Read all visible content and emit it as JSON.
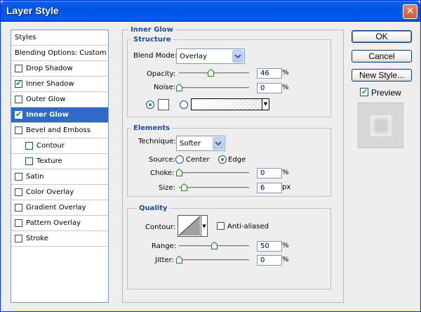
{
  "window": {
    "title": "Layer Style",
    "close_glyph": "✕"
  },
  "styles": {
    "header": "Styles",
    "blending": "Blending Options: Custom",
    "items": [
      {
        "label": "Drop Shadow",
        "checked": false,
        "indent": false,
        "selected": false
      },
      {
        "label": "Inner Shadow",
        "checked": true,
        "indent": false,
        "selected": false
      },
      {
        "label": "Outer Glow",
        "checked": false,
        "indent": false,
        "selected": false
      },
      {
        "label": "Inner Glow",
        "checked": true,
        "indent": false,
        "selected": true
      },
      {
        "label": "Bevel and Emboss",
        "checked": false,
        "indent": false,
        "selected": false
      },
      {
        "label": "Contour",
        "checked": false,
        "indent": true,
        "selected": false
      },
      {
        "label": "Texture",
        "checked": false,
        "indent": true,
        "selected": false
      },
      {
        "label": "Satin",
        "checked": false,
        "indent": false,
        "selected": false
      },
      {
        "label": "Color Overlay",
        "checked": false,
        "indent": false,
        "selected": false
      },
      {
        "label": "Gradient Overlay",
        "checked": false,
        "indent": false,
        "selected": false
      },
      {
        "label": "Pattern Overlay",
        "checked": false,
        "indent": false,
        "selected": false
      },
      {
        "label": "Stroke",
        "checked": false,
        "indent": false,
        "selected": false
      }
    ]
  },
  "inner_glow": {
    "title": "Inner Glow",
    "structure": {
      "title": "Structure",
      "blend_mode_label": "Blend Mode:",
      "blend_mode_value": "Overlay",
      "opacity_label": "Opacity:",
      "opacity_value": "46",
      "opacity_unit": "%",
      "noise_label": "Noise:",
      "noise_value": "0",
      "noise_unit": "%"
    },
    "elements": {
      "title": "Elements",
      "technique_label": "Technique:",
      "technique_value": "Softer",
      "source_label": "Source:",
      "source_center": "Center",
      "source_edge": "Edge",
      "choke_label": "Choke:",
      "choke_value": "0",
      "choke_unit": "%",
      "size_label": "Size:",
      "size_value": "6",
      "size_unit": "px"
    },
    "quality": {
      "title": "Quality",
      "contour_label": "Contour:",
      "antialiased_label": "Anti-aliased",
      "range_label": "Range:",
      "range_value": "50",
      "range_unit": "%",
      "jitter_label": "Jitter:",
      "jitter_value": "0",
      "jitter_unit": "%"
    }
  },
  "buttons": {
    "ok": "OK",
    "cancel": "Cancel",
    "new_style": "New Style...",
    "preview_label": "Preview"
  },
  "colors": {
    "accent": "#316ac5",
    "title_blue": "#1c4c9c",
    "titlebar": "#0054e3",
    "check_green": "#21a121"
  }
}
